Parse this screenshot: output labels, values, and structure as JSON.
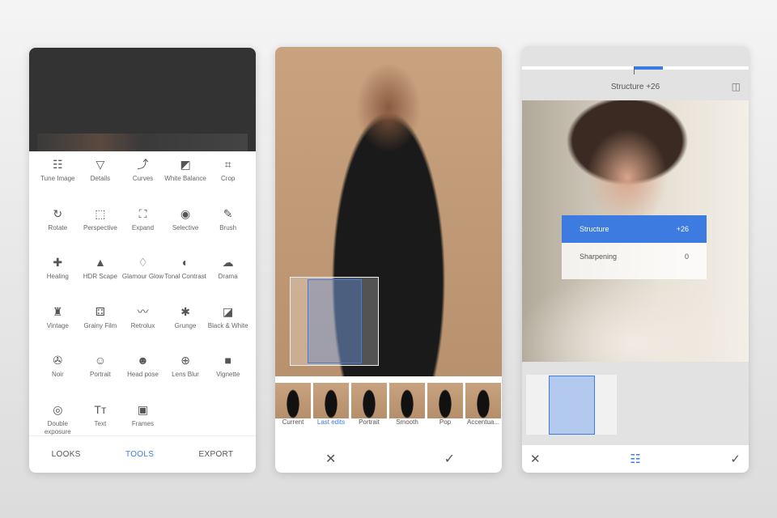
{
  "tools": [
    {
      "label": "Tune Image",
      "icon": "☷"
    },
    {
      "label": "Details",
      "icon": "▽"
    },
    {
      "label": "Curves",
      "icon": "⤴"
    },
    {
      "label": "White Balance",
      "icon": "◩"
    },
    {
      "label": "Crop",
      "icon": "⌗"
    },
    {
      "label": "Rotate",
      "icon": "↻"
    },
    {
      "label": "Perspective",
      "icon": "⬚"
    },
    {
      "label": "Expand",
      "icon": "⛶"
    },
    {
      "label": "Selective",
      "icon": "◉"
    },
    {
      "label": "Brush",
      "icon": "✎"
    },
    {
      "label": "Healing",
      "icon": "✚"
    },
    {
      "label": "HDR Scape",
      "icon": "▲"
    },
    {
      "label": "Glamour Glow",
      "icon": "♢"
    },
    {
      "label": "Tonal Contrast",
      "icon": "◐"
    },
    {
      "label": "Drama",
      "icon": "☁"
    },
    {
      "label": "Vintage",
      "icon": "♜"
    },
    {
      "label": "Grainy Film",
      "icon": "⚃"
    },
    {
      "label": "Retrolux",
      "icon": "〰"
    },
    {
      "label": "Grunge",
      "icon": "✱"
    },
    {
      "label": "Black & White",
      "icon": "◪"
    },
    {
      "label": "Noir",
      "icon": "✇"
    },
    {
      "label": "Portrait",
      "icon": "☺"
    },
    {
      "label": "Head pose",
      "icon": "☻"
    },
    {
      "label": "Lens Blur",
      "icon": "⊕"
    },
    {
      "label": "Vignette",
      "icon": "■"
    },
    {
      "label": "Double exposure",
      "icon": "◎"
    },
    {
      "label": "Text",
      "icon": "Tт"
    },
    {
      "label": "Frames",
      "icon": "▣"
    }
  ],
  "tabs": {
    "looks": "LOOKS",
    "tools": "TOOLS",
    "export": "EXPORT"
  },
  "looks": [
    "Current",
    "Last edits",
    "Portrait",
    "Smooth",
    "Pop",
    "Accentua..."
  ],
  "editor": {
    "title": "Structure +26",
    "menu": [
      {
        "label": "Structure",
        "value": "+26"
      },
      {
        "label": "Sharpening",
        "value": "0"
      }
    ]
  },
  "icons": {
    "close": "✕",
    "check": "✓",
    "sliders": "☷",
    "compare": "◫"
  }
}
